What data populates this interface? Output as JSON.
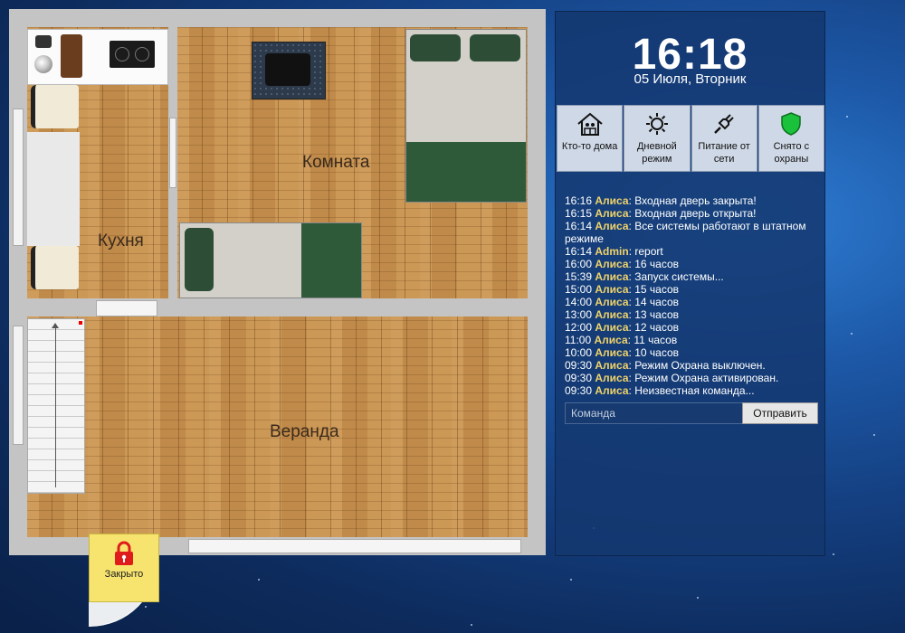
{
  "rooms": {
    "kitchen": "Кухня",
    "room": "Комната",
    "veranda": "Веранда"
  },
  "front_door": {
    "label": "Закрыто",
    "icon": "lock-icon",
    "color": "#f7e46f"
  },
  "panel": {
    "time": "16:18",
    "date": "05 Июля, Вторник",
    "status": [
      {
        "icon": "home-icon",
        "label": "Кто-то дома"
      },
      {
        "icon": "sun-icon",
        "label": "Дневной режим"
      },
      {
        "icon": "plug-icon",
        "label": "Питание от сети"
      },
      {
        "icon": "shield-icon",
        "label": "Снято с охраны"
      }
    ],
    "log": [
      {
        "time": "16:16",
        "user": "Алиса",
        "text": "Входная дверь закрыта!"
      },
      {
        "time": "16:15",
        "user": "Алиса",
        "text": "Входная дверь открыта!"
      },
      {
        "time": "16:14",
        "user": "Алиса",
        "text": "Все системы работают в штатном режиме"
      },
      {
        "time": "16:14",
        "user": "Admin",
        "text": "report"
      },
      {
        "time": "16:00",
        "user": "Алиса",
        "text": "16 часов"
      },
      {
        "time": "15:39",
        "user": "Алиса",
        "text": "Запуск системы..."
      },
      {
        "time": "15:00",
        "user": "Алиса",
        "text": "15 часов"
      },
      {
        "time": "14:00",
        "user": "Алиса",
        "text": "14 часов"
      },
      {
        "time": "13:00",
        "user": "Алиса",
        "text": "13 часов"
      },
      {
        "time": "12:00",
        "user": "Алиса",
        "text": "12 часов"
      },
      {
        "time": "11:00",
        "user": "Алиса",
        "text": "11 часов"
      },
      {
        "time": "10:00",
        "user": "Алиса",
        "text": "10 часов"
      },
      {
        "time": "09:30",
        "user": "Алиса",
        "text": "Режим Охрана выключен."
      },
      {
        "time": "09:30",
        "user": "Алиса",
        "text": "Режим Охрана активирован."
      },
      {
        "time": "09:30",
        "user": "Алиса",
        "text": "Неизвестная команда..."
      }
    ],
    "command": {
      "placeholder": "Команда",
      "value": ""
    },
    "send_label": "Отправить",
    "colors": {
      "user": "#f0d36a",
      "shield": "#19c23a",
      "lock": "#e01b1b"
    }
  }
}
